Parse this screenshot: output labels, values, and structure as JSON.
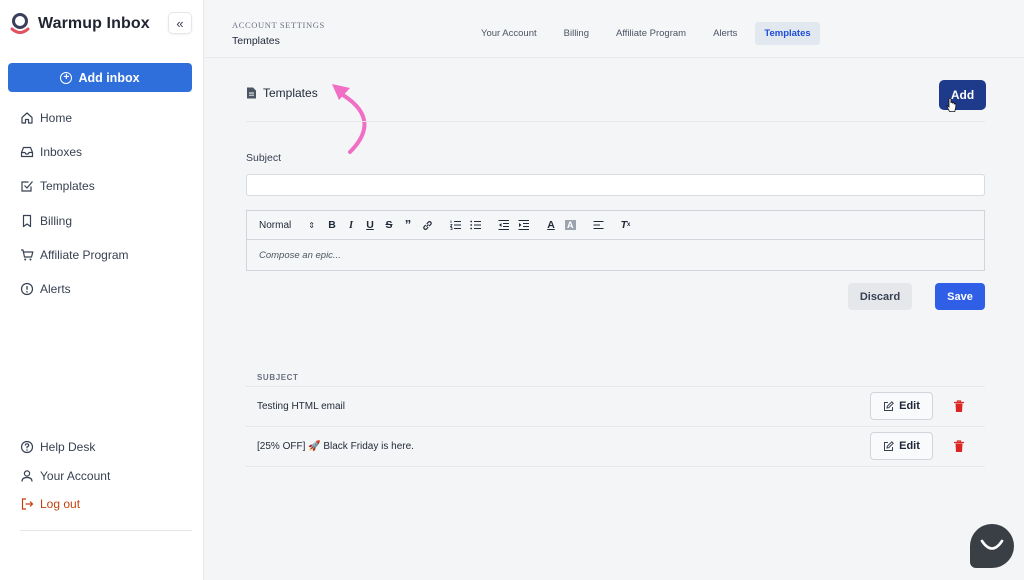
{
  "brand": {
    "name": "Warmup Inbox",
    "logo_color": "#e05260"
  },
  "sidebar": {
    "collapse_icon": "«",
    "add_inbox_label": "Add inbox",
    "items": [
      {
        "label": "Home",
        "icon": "home-icon"
      },
      {
        "label": "Inboxes",
        "icon": "inbox-icon"
      },
      {
        "label": "Templates",
        "icon": "checkbox-icon"
      },
      {
        "label": "Billing",
        "icon": "bookmark-icon"
      },
      {
        "label": "Affiliate Program",
        "icon": "cart-icon"
      },
      {
        "label": "Alerts",
        "icon": "alert-icon"
      }
    ],
    "bottom_items": [
      {
        "label": "Help Desk",
        "icon": "help-icon"
      },
      {
        "label": "Your Account",
        "icon": "user-icon"
      },
      {
        "label": "Log out",
        "icon": "logout-icon"
      }
    ]
  },
  "header": {
    "crumb_top": "ACCOUNT SETTINGS",
    "crumb_main": "Templates",
    "tabs": [
      {
        "label": "Your Account"
      },
      {
        "label": "Billing"
      },
      {
        "label": "Affiliate Program"
      },
      {
        "label": "Alerts"
      },
      {
        "label": "Templates",
        "active": true
      }
    ]
  },
  "main": {
    "section_title": "Templates",
    "add_label": "Add",
    "subject_label": "Subject",
    "subject_value": "",
    "editor": {
      "format_select": "Normal",
      "placeholder": "Compose an epic...",
      "tools": [
        "bold",
        "italic",
        "underline",
        "strike",
        "blockquote",
        "link",
        "ordered-list",
        "bullet-list",
        "outdent",
        "indent",
        "text-color",
        "background-color",
        "align",
        "clean"
      ]
    },
    "discard_label": "Discard",
    "save_label": "Save",
    "table": {
      "header": "SUBJECT",
      "rows": [
        {
          "subject": "Testing HTML email",
          "edit_label": "Edit"
        },
        {
          "subject": "[25% OFF] 🚀 Black Friday is here.",
          "edit_label": "Edit"
        }
      ]
    }
  },
  "colors": {
    "accent": "#2f6fdc",
    "add_button": "#1e3a8a",
    "save_button": "#2f5fe6",
    "annotation_arrow": "#f06ec4",
    "delete": "#dc2626"
  }
}
